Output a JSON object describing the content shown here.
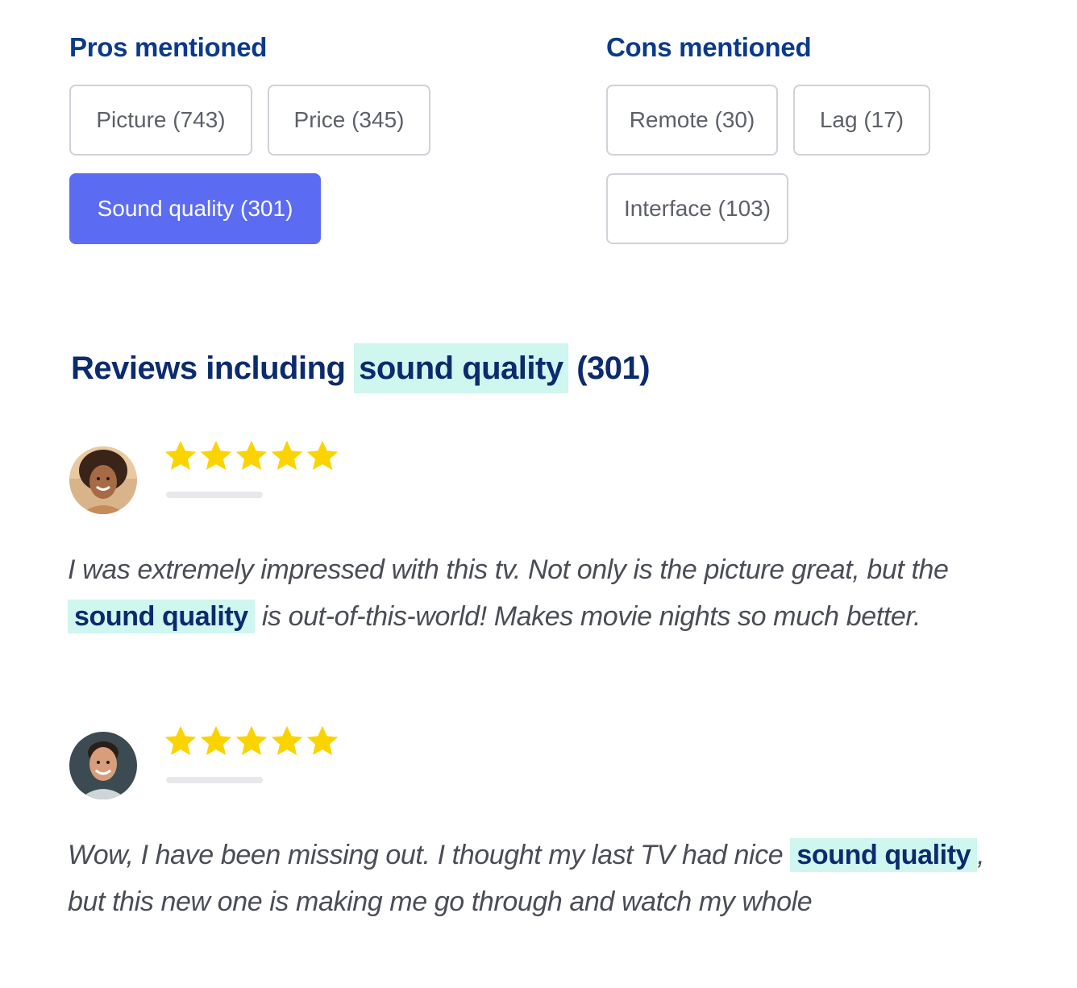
{
  "pros": {
    "title": "Pros mentioned",
    "chips": [
      {
        "label": "Picture (743)",
        "selected": false
      },
      {
        "label": "Price (345)",
        "selected": false
      },
      {
        "label": "Sound quality (301)",
        "selected": true
      }
    ]
  },
  "cons": {
    "title": "Cons mentioned",
    "chips": [
      {
        "label": "Remote (30)",
        "selected": false
      },
      {
        "label": "Lag (17)",
        "selected": false
      },
      {
        "label": "Interface (103)",
        "selected": false
      }
    ]
  },
  "reviews_heading": {
    "prefix": "Reviews including",
    "highlight": "sound quality",
    "count": "(301)"
  },
  "reviews": [
    {
      "rating": 5,
      "text_before": "I was extremely impressed with this tv. Not only is the picture great, but the",
      "highlight": "sound quality",
      "text_after": "is out-of-this-world! Makes movie nights so much better."
    },
    {
      "rating": 5,
      "text_before": "Wow, I have been missing out. I thought my last TV had nice",
      "highlight": "sound quality",
      "text_after": ", but this new one is making me go through and watch my whole"
    }
  ],
  "colors": {
    "accent": "#5b6cf2",
    "highlight": "#cff6ef",
    "star": "#fbd400",
    "heading": "#0b3a8a"
  }
}
